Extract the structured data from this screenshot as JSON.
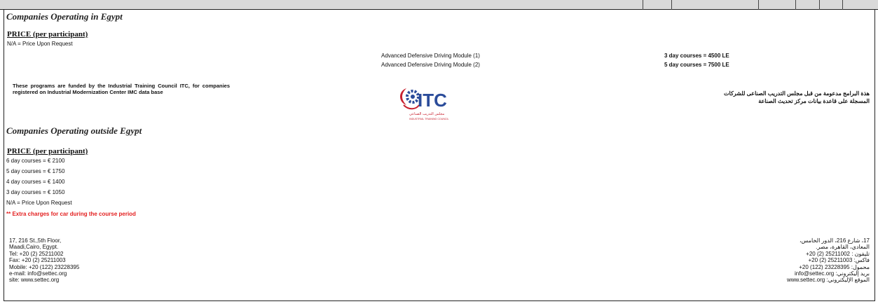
{
  "egypt": {
    "title": "Companies Operating in Egypt",
    "price_heading": "PRICE (per participant)",
    "na_line": "N/A  = Price Upon Request",
    "modules": [
      {
        "name": "Advanced Defensive Driving Module (1)",
        "price": "3 day courses = 4500 LE"
      },
      {
        "name": "Advanced Defensive Driving Module (2)",
        "price": "5 day courses = 7500 LE"
      }
    ],
    "funded_text": "These programs are funded by the Industrial Training Council ITC, for companies registered on Industrial Modernization Center IMC data base",
    "arabic_funded_line1": "هذة البرامج مدعومة من قبل مجلس التدريب الصناعى للشركات",
    "arabic_funded_line2": "المسجلة على قاعدة بيانات مركز تحديث الصناعة"
  },
  "logo": {
    "text": "ITC",
    "arabic": "مجلس التدريب الصناعي",
    "english": "INDUSTRIAL TRAINING COUNCIL",
    "colors": {
      "red": "#c8202e",
      "blue": "#2b4c9a"
    }
  },
  "outside": {
    "title": "Companies Operating outside Egypt",
    "price_heading": "PRICE (per participant)",
    "prices": [
      "6 day courses = € 2100",
      "5 day courses = € 1750",
      "4 day courses = € 1400",
      "3 day courses =  € 1050",
      "N/A  = Price Upon Request"
    ],
    "extra_note": "** Extra charges for car during the course period"
  },
  "address_en": [
    "17, 216 St.,5th Floor,",
    " Maadi,Cairo, Egypt.",
    "Tel: +20 (2) 25211002",
    "Fax: +20 (2) 25211003",
    "Mobile: +20 (122) 23228395",
    "e-mail: info@settec.org",
    "site: www.settec.org"
  ],
  "address_ar": [
    "17، شارع 216، الدور الخامس،",
    "المعادي، القاهرة، مصر.",
    "تليفون : 25211002 (2) 20+",
    "فاكس: 25211003 (2) 20+",
    "محمول: 23228395 (122) 20+",
    "بريد إليكتروني: info@settec.org",
    "الموقع الإليكتروني: www.settec.org"
  ]
}
